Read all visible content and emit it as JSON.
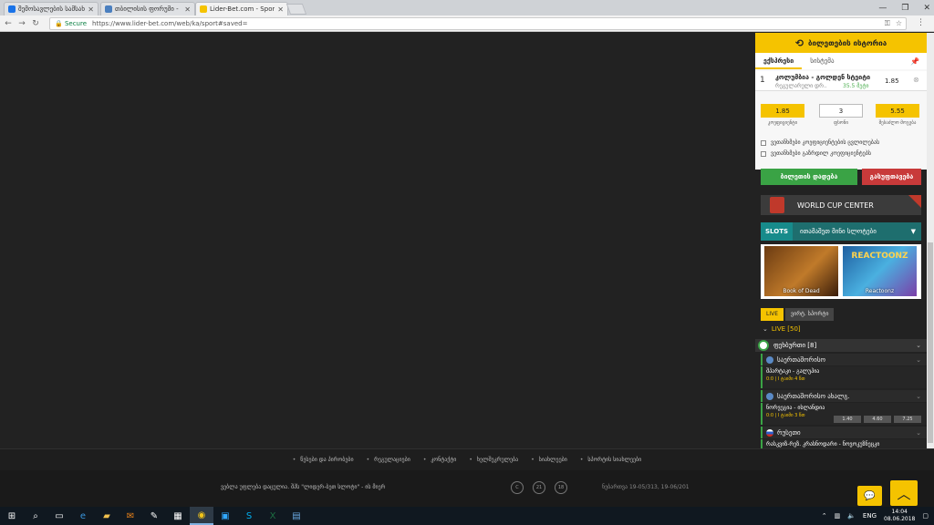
{
  "browser": {
    "tabs": [
      {
        "title": "შემოსავლების სამსახ",
        "favicon_color": "#1a73e8"
      },
      {
        "title": "თბილისის ფორუმი -",
        "favicon_color": "#4a7fbf"
      },
      {
        "title": "Lider-Bet.com - Sports a",
        "favicon_color": "#f5c300"
      }
    ],
    "secure_label": "Secure",
    "url": "https://www.lider-bet.com/web/ka/sport#saved="
  },
  "betslip": {
    "header": "ბილეთების ისტორია",
    "tabs": [
      "ექსპრესი",
      "სისტემა"
    ],
    "selection": {
      "num": "1",
      "match": "კოლუმბია - გოლდენ სტეიტი",
      "market": "რეგულარული დრ..",
      "score": "35.5 მეტი",
      "odd": "1.85"
    },
    "boxes": [
      {
        "value": "1.85",
        "label": "კოეფიციენტი"
      },
      {
        "value": "3",
        "label": "ფსონი"
      },
      {
        "value": "5.55",
        "label": "შესაძლო მოგება"
      }
    ],
    "checks": [
      "ვეთანხმები კოეფიციენტების ცვლილებას",
      "ვეთანხმები გაზრდილ კოეფიციენტებს"
    ],
    "place_label": "ბილეთის დადება",
    "clear_label": "გასუფთავება"
  },
  "promo": {
    "world_cup": "WORLD CUP CENTER",
    "slots_tag": "SLOTS",
    "slots_name": "ითამაშეთ მინი სლოტები",
    "games": [
      {
        "name": "Book of Dead"
      },
      {
        "name": "Reactoonz",
        "logo": "REACTOONZ"
      }
    ]
  },
  "live": {
    "tabs": [
      "LIVE",
      "ვირტ. სპორტი"
    ],
    "count": "LIVE [50]",
    "sport": "ფეხბურთი [8]",
    "leagues": [
      {
        "name": "საერთაშორისო",
        "matches": [
          {
            "teams": "შპარტაკი - გალუჰია",
            "meta": "0:0 | I ტაიმი 4 წთ"
          }
        ]
      },
      {
        "name": "საერთაშორისო ახალგ.",
        "matches": [
          {
            "teams": "ნორვეგია - ისლანდია",
            "meta": "0:0 | I ტაიმი 3 წთ",
            "odds": [
              "1.40",
              "4.60",
              "7.25"
            ]
          }
        ]
      },
      {
        "name": "რუსეთი",
        "matches": [
          {
            "teams": "რასკვიზ-რეზ. კრასნოდარი - ნოვოკუზნეცკი",
            "meta": ""
          }
        ]
      }
    ]
  },
  "footer": {
    "links": [
      "წესები და პირობები",
      "რეგულაციები",
      "კონტაქტი",
      "ხელშეკრულება",
      "სიახლეები",
      "სპორტის სიახლეები"
    ],
    "cookie": "ვებლა უფლება დაცულია. შპს \"ლიდერ-ბეთ სლოტი\" - ის მიერ",
    "circles": [
      "C",
      "21",
      "18"
    ],
    "license": "ნებართვა 19-05/313, 19-06/201"
  },
  "taskbar": {
    "lang": "ENG",
    "time": "14:04",
    "date": "08.06.2018"
  }
}
